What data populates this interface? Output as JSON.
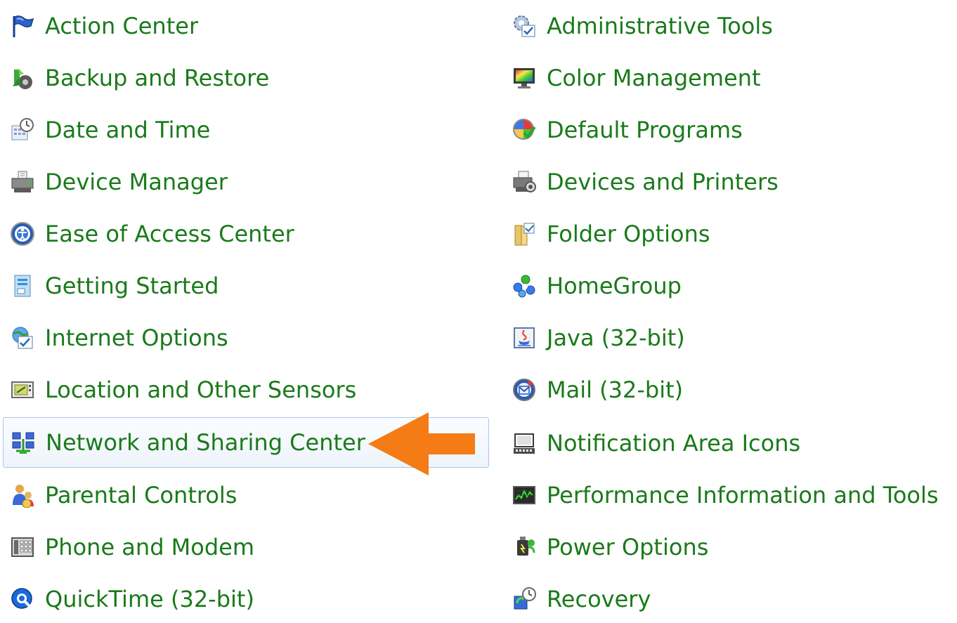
{
  "accent_color": "#1a7a1a",
  "highlight_arrow_color": "#f47b16",
  "selected_item": "Network and Sharing Center",
  "left_column": [
    {
      "label": "Action Center",
      "icon": "flag-icon"
    },
    {
      "label": "Backup and Restore",
      "icon": "backup-icon"
    },
    {
      "label": "Date and Time",
      "icon": "calendar-clock-icon"
    },
    {
      "label": "Device Manager",
      "icon": "printer-device-icon"
    },
    {
      "label": "Ease of Access Center",
      "icon": "accessibility-icon"
    },
    {
      "label": "Getting Started",
      "icon": "document-start-icon"
    },
    {
      "label": "Internet Options",
      "icon": "globe-checklist-icon"
    },
    {
      "label": "Location and Other Sensors",
      "icon": "sensor-icon"
    },
    {
      "label": "Network and Sharing Center",
      "icon": "network-icon"
    },
    {
      "label": "Parental Controls",
      "icon": "parental-icon"
    },
    {
      "label": "Phone and Modem",
      "icon": "phone-icon"
    },
    {
      "label": "QuickTime (32-bit)",
      "icon": "quicktime-icon"
    }
  ],
  "right_column": [
    {
      "label": "Administrative Tools",
      "icon": "admin-tools-icon"
    },
    {
      "label": "Color Management",
      "icon": "color-monitor-icon"
    },
    {
      "label": "Default Programs",
      "icon": "default-programs-icon"
    },
    {
      "label": "Devices and Printers",
      "icon": "printer-icon"
    },
    {
      "label": "Folder Options",
      "icon": "folder-options-icon"
    },
    {
      "label": "HomeGroup",
      "icon": "homegroup-icon"
    },
    {
      "label": "Java (32-bit)",
      "icon": "java-icon"
    },
    {
      "label": "Mail (32-bit)",
      "icon": "mail-icon"
    },
    {
      "label": "Notification Area Icons",
      "icon": "notification-icon"
    },
    {
      "label": "Performance Information and Tools",
      "icon": "performance-icon"
    },
    {
      "label": "Power Options",
      "icon": "power-icon"
    },
    {
      "label": "Recovery",
      "icon": "recovery-icon"
    }
  ]
}
